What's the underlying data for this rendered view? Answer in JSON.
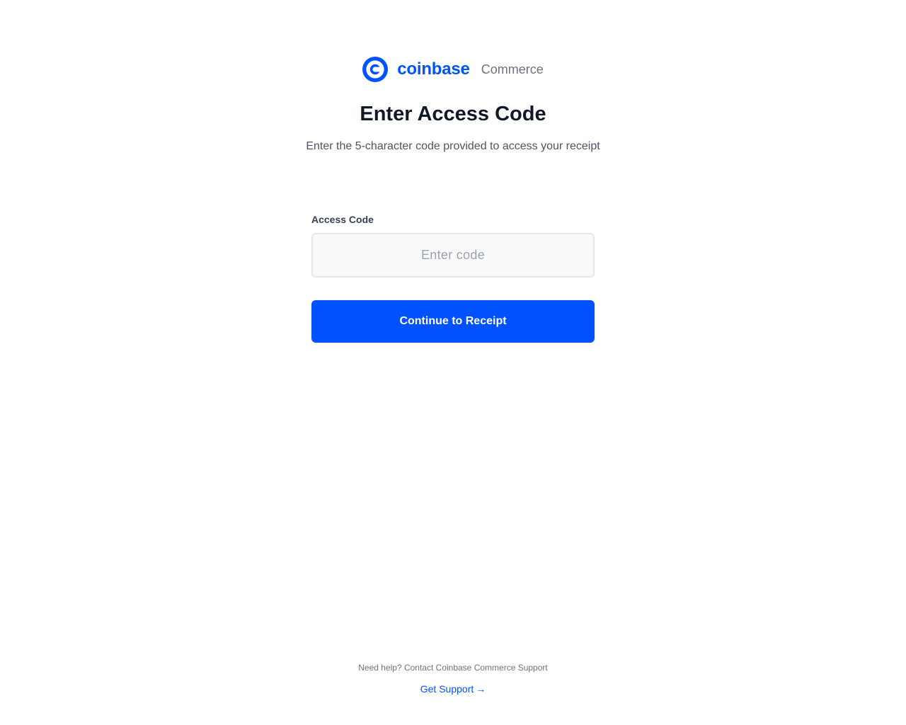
{
  "brand": {
    "logo_icon": "coinbase-c-logo-icon",
    "name": "coinbase",
    "product": "Commerce",
    "color": "#0052ff"
  },
  "header": {
    "title": "Enter Access Code",
    "subtitle": "Enter the 5-character code provided to access your receipt"
  },
  "form": {
    "label": "Access Code",
    "input_value": "",
    "input_placeholder": "Enter code",
    "submit_label": "Continue to Receipt"
  },
  "footer": {
    "help_text": "Need help? Contact Coinbase Commerce Support",
    "link_label": "Get Support",
    "link_arrow": "→"
  }
}
